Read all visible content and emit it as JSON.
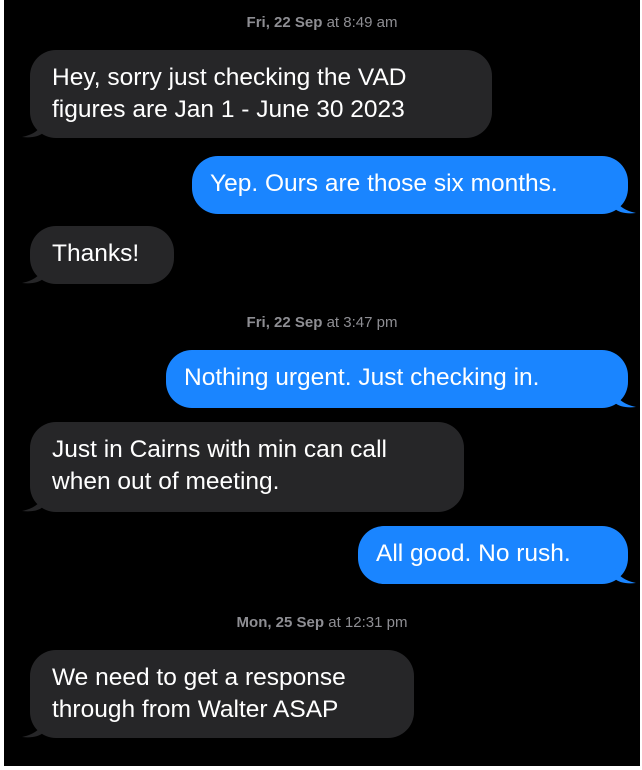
{
  "timestamps": [
    {
      "day": "Fri, 22 Sep",
      "time": "at 8:49 am"
    },
    {
      "day": "Fri, 22 Sep",
      "time": "at 3:47 pm"
    },
    {
      "day": "Mon, 25 Sep",
      "time": "at 12:31 pm"
    }
  ],
  "messages": [
    {
      "direction": "received",
      "lines": [
        "Hey, sorry just checking the VAD",
        "figures are Jan 1 - June 30 2023"
      ]
    },
    {
      "direction": "sent",
      "lines": [
        "Yep. Ours are those six months."
      ]
    },
    {
      "direction": "received",
      "lines": [
        "Thanks!"
      ]
    },
    {
      "direction": "sent",
      "lines": [
        "Nothing urgent. Just checking in."
      ]
    },
    {
      "direction": "received",
      "lines": [
        "Just in Cairns with min can call",
        "when out of meeting."
      ]
    },
    {
      "direction": "sent",
      "lines": [
        "All good. No rush."
      ]
    },
    {
      "direction": "received",
      "lines": [
        "We need to get a response",
        "through from Walter ASAP"
      ]
    }
  ],
  "colors": {
    "background": "#000000",
    "received_bubble": "#262628",
    "sent_bubble": "#1a85ff",
    "timestamp_text": "#8e8e93",
    "message_text": "#ffffff"
  }
}
